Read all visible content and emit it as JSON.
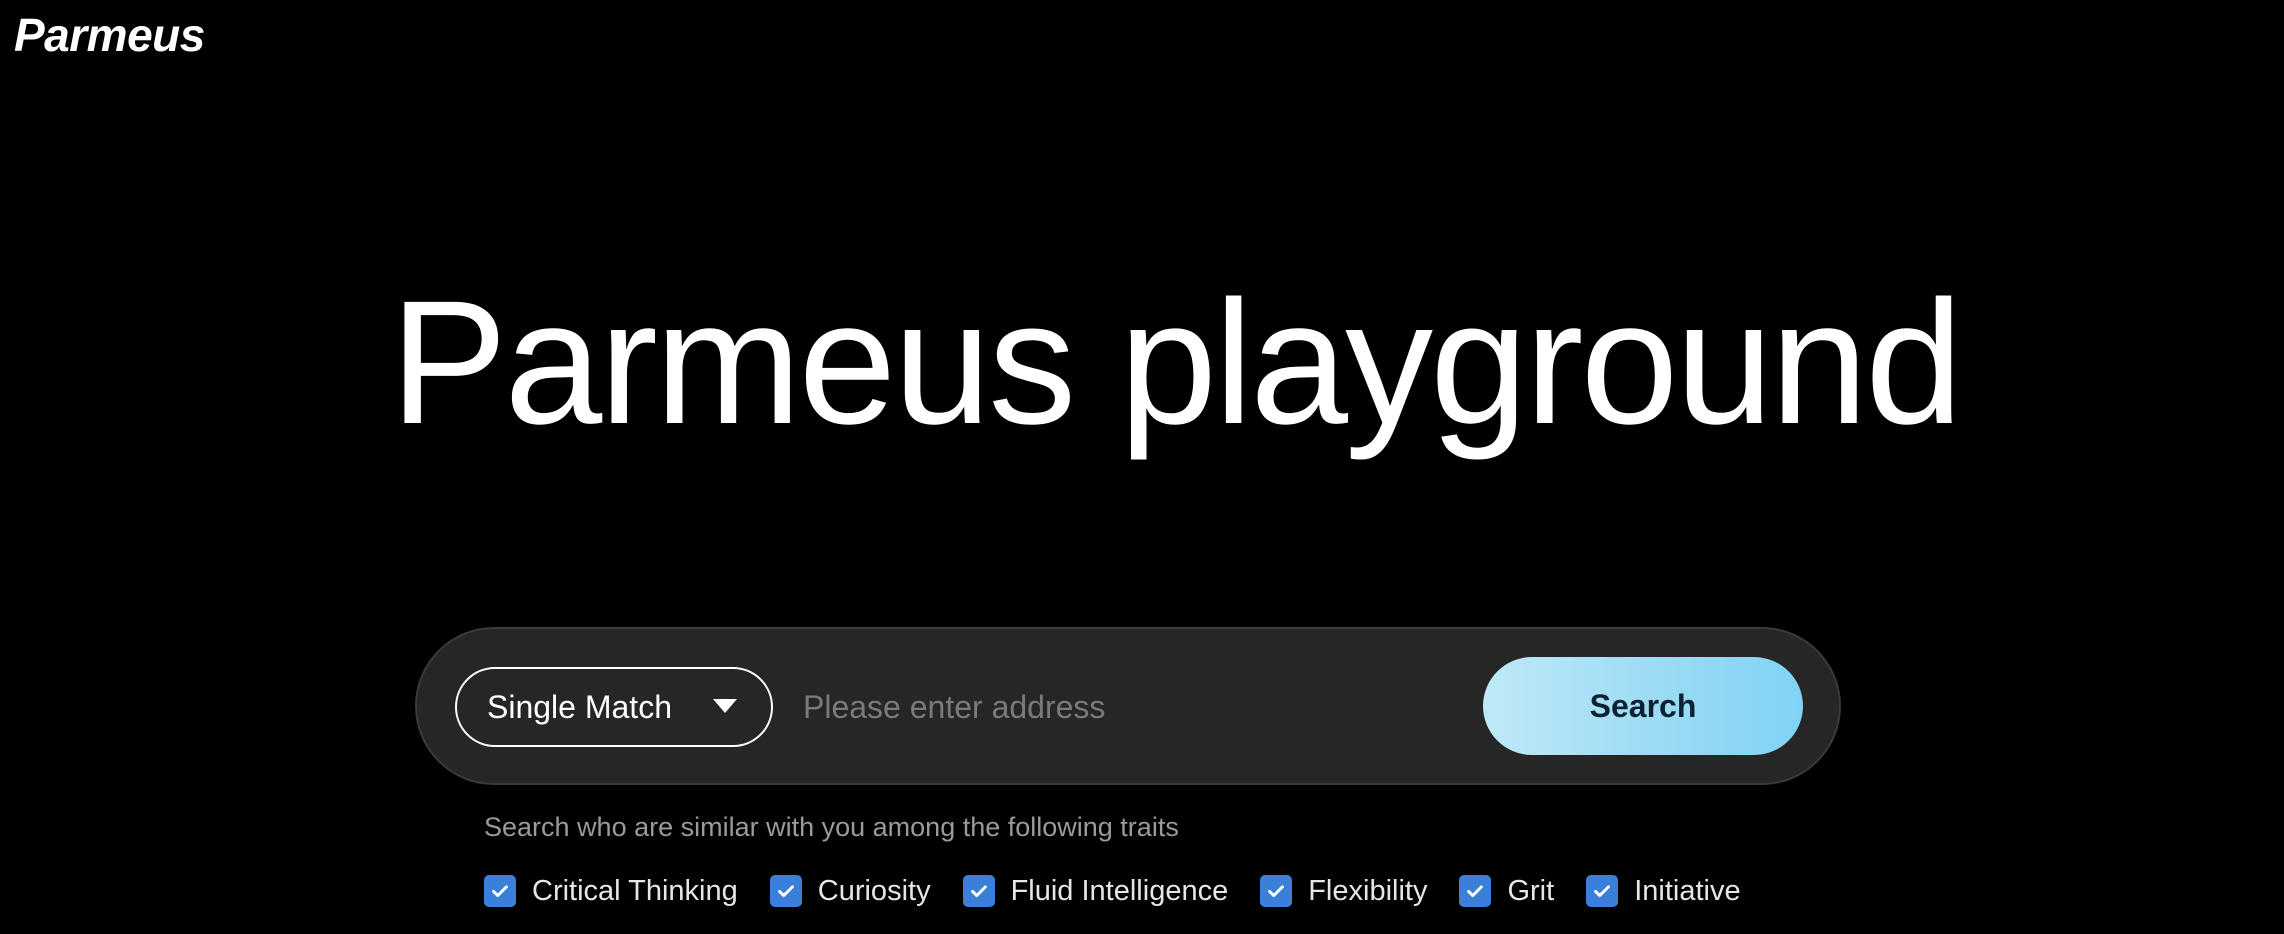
{
  "header": {
    "logo_text": "Parmeus"
  },
  "hero": {
    "title": "Parmeus playground"
  },
  "search": {
    "mode_selected": "Single Match",
    "mode_icon": "chevron-down-icon",
    "placeholder": "Please enter address",
    "value": "",
    "button_label": "Search",
    "button_gradient": [
      "#bfe9f7",
      "#7fd3f5"
    ]
  },
  "traits": {
    "helper_text": "Search who are similar with you among the following traits",
    "items": [
      {
        "label": "Critical Thinking",
        "checked": true
      },
      {
        "label": "Curiosity",
        "checked": true
      },
      {
        "label": "Fluid Intelligence",
        "checked": true
      },
      {
        "label": "Flexibility",
        "checked": true
      },
      {
        "label": "Grit",
        "checked": true
      },
      {
        "label": "Initiative",
        "checked": true
      }
    ],
    "checkbox_color": "#3a7fd9"
  },
  "colors": {
    "background": "#000000",
    "search_bar": "#262626",
    "text": "#ffffff",
    "muted": "#9a9a9a"
  }
}
